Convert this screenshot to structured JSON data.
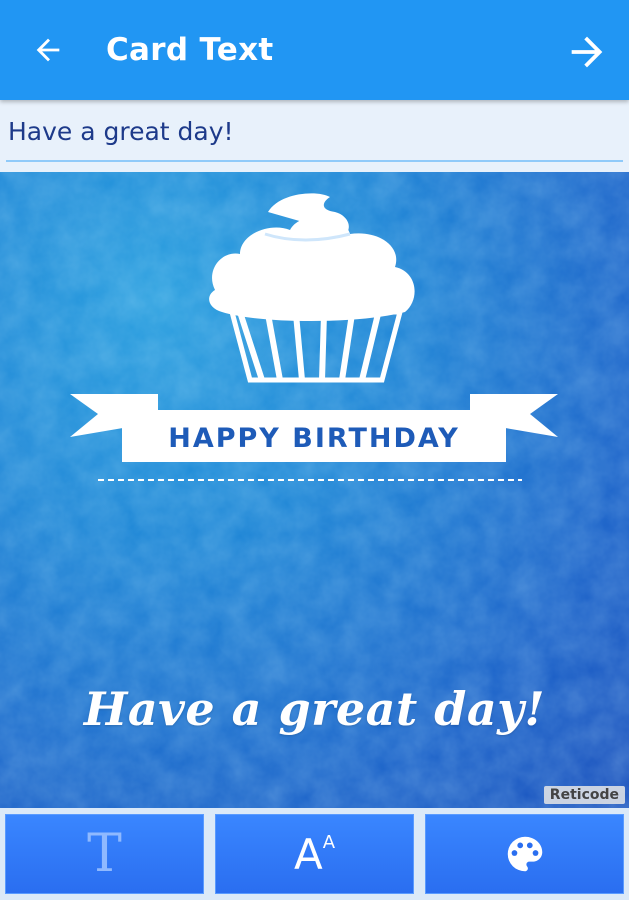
{
  "appbar": {
    "title": "Card Text",
    "back_icon": "arrow-back-icon",
    "next_icon": "arrow-forward-icon",
    "color": "#2196f3"
  },
  "input": {
    "value": "Have a great day!"
  },
  "card": {
    "banner_text": "HAPPY BIRTHDAY",
    "greeting": "Have a great day!",
    "watermark": "Reticode",
    "background_color": "#1f7dd4"
  },
  "toolbar": {
    "font_label": "T",
    "size_label": "A",
    "size_label_sup": "A",
    "items": [
      {
        "icon": "text-font-icon"
      },
      {
        "icon": "text-size-icon"
      },
      {
        "icon": "palette-icon"
      }
    ],
    "button_color": "#3a86ff"
  }
}
